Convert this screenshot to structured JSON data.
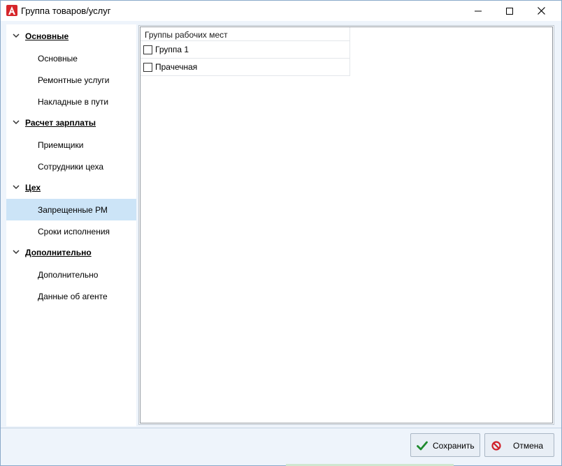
{
  "window": {
    "title": "Группа товаров/услуг",
    "icons": {
      "app": "app-logo-a-icon",
      "minimize": "minimize-icon",
      "maximize": "maximize-icon",
      "close": "close-icon"
    }
  },
  "nav": {
    "groups": [
      {
        "label": "Основные",
        "items": [
          "Основные",
          "Ремонтные услуги",
          "Накладные в пути"
        ]
      },
      {
        "label": "Расчет зарплаты",
        "items": [
          "Приемщики",
          "Сотрудники цеха"
        ]
      },
      {
        "label": "Цех",
        "items": [
          "Запрещенные РМ",
          "Сроки исполнения"
        ]
      },
      {
        "label": "Дополнительно",
        "items": [
          "Дополнительно",
          "Данные об агенте"
        ]
      }
    ],
    "selected_item": "Запрещенные РМ"
  },
  "panel": {
    "header": "Группы рабочих мест",
    "rows": [
      {
        "label": "Группа 1",
        "checked": false
      },
      {
        "label": "Прачечная",
        "checked": false
      }
    ]
  },
  "footer": {
    "save_label": "Сохранить",
    "cancel_label": "Отмена",
    "save_icon": "checkmark-icon",
    "cancel_icon": "prohibited-icon"
  },
  "colors": {
    "selection": "#cce4f7",
    "save_check": "#1f8a2e",
    "cancel_red": "#d0202a",
    "window_bg": "#eef4fb"
  }
}
